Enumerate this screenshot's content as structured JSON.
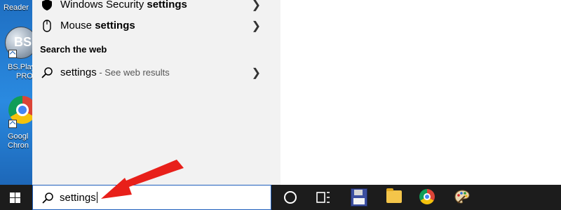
{
  "desktop": {
    "icons": [
      {
        "label": "Reader"
      },
      {
        "label": "BS.Player PRO",
        "line1": "BS.Play",
        "line2": "PRO"
      },
      {
        "label": "Google Chrome",
        "line1": "Googl",
        "line2": "Chron"
      }
    ],
    "bs_logo_text": "BS"
  },
  "results": {
    "items": [
      {
        "prefix": "Windows Security ",
        "bold": "settings",
        "icon": "shield-icon"
      },
      {
        "prefix": "Mouse ",
        "bold": "settings",
        "icon": "mouse-icon"
      }
    ],
    "web_section_title": "Search the web",
    "web_result": {
      "query": "settings",
      "suffix": " - See web results",
      "icon": "search-icon"
    }
  },
  "taskbar": {
    "search_query": "settings",
    "icons": [
      "windows-start-icon",
      "cortana-icon",
      "task-view-icon",
      "floppy-disk-icon",
      "file-explorer-icon",
      "chrome-icon",
      "paint-palette-icon"
    ]
  },
  "colors": {
    "panel_bg": "#f2f2f2",
    "taskbar_bg": "#1c1c1c",
    "arrow": "#e8201a",
    "search_border": "#1e5fbd"
  }
}
